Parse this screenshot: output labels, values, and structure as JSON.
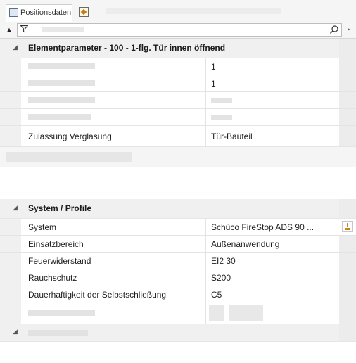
{
  "tabs": {
    "active_label": "Positionsdaten"
  },
  "icons": {
    "collapse": "collapse-all-icon",
    "filter": "filter-icon",
    "search": "search-icon",
    "scroll": "scroll-right-icon",
    "ellipsis": "ellipsis-button-icon"
  },
  "symbols": {
    "collapse": "▲",
    "scroll": "▸",
    "group_expanded": "◢"
  },
  "groups": {
    "elementparameter": {
      "title": "Elementparameter - 100 - 1-flg. Tür innen öffnend",
      "rows": [
        {
          "name": "",
          "value": "1"
        },
        {
          "name": "",
          "value": "1"
        },
        {
          "name": "",
          "value": ""
        },
        {
          "name": "",
          "value": ""
        },
        {
          "name": "Zulassung Verglasung",
          "value": "Tür-Bauteil"
        }
      ]
    },
    "system": {
      "title": "System / Profile",
      "rows": [
        {
          "name": "System",
          "value": "Schüco FireStop ADS 90 ..."
        },
        {
          "name": "Einsatzbereich",
          "value": "Außenanwendung"
        },
        {
          "name": "Feuerwiderstand",
          "value": "EI2 30"
        },
        {
          "name": "Rauchschutz",
          "value": "S200"
        },
        {
          "name": "Dauerhaftigkeit der Selbstschließung",
          "value": "C5"
        },
        {
          "name": "",
          "value": ""
        }
      ]
    }
  },
  "colors": {
    "header_bg": "#f0f0f0",
    "grid_line": "#e4e4e4",
    "accent_orange": "#c98420"
  }
}
